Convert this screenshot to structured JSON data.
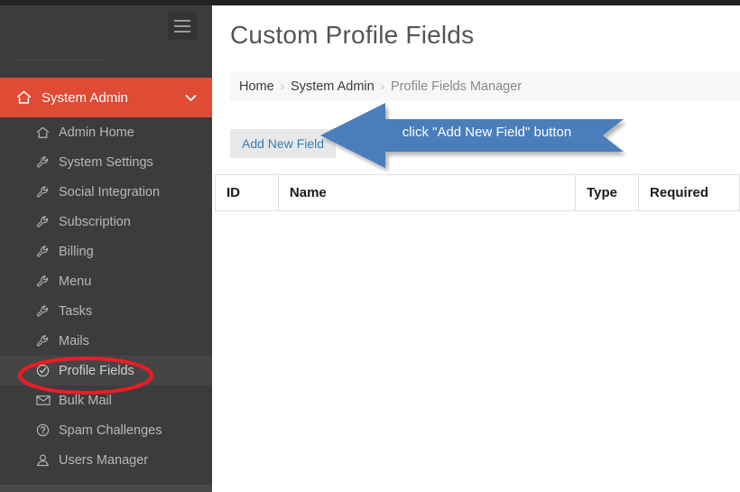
{
  "sidebar": {
    "hamburger_icon": "hamburger-menu-icon",
    "section": {
      "icon": "home-icon",
      "label": "System Admin",
      "chevron_icon": "chevron-down-icon"
    },
    "items": [
      {
        "label": "Admin Home",
        "icon": "home-icon",
        "active": false
      },
      {
        "label": "System Settings",
        "icon": "wrench-icon",
        "active": false
      },
      {
        "label": "Social Integration",
        "icon": "wrench-icon",
        "active": false
      },
      {
        "label": "Subscription",
        "icon": "wrench-icon",
        "active": false
      },
      {
        "label": "Billing",
        "icon": "wrench-icon",
        "active": false
      },
      {
        "label": "Menu",
        "icon": "wrench-icon",
        "active": false
      },
      {
        "label": "Tasks",
        "icon": "wrench-icon",
        "active": false
      },
      {
        "label": "Mails",
        "icon": "wrench-icon",
        "active": false
      },
      {
        "label": "Profile Fields",
        "icon": "check-circle-icon",
        "active": true
      },
      {
        "label": "Bulk Mail",
        "icon": "envelope-icon",
        "active": false
      },
      {
        "label": "Spam Challenges",
        "icon": "question-circle-icon",
        "active": false
      },
      {
        "label": "Users Manager",
        "icon": "user-icon",
        "active": false
      }
    ]
  },
  "main": {
    "title": "Custom Profile Fields",
    "breadcrumb": [
      {
        "label": "Home",
        "last": false
      },
      {
        "label": "System Admin",
        "last": false
      },
      {
        "label": "Profile Fields Manager",
        "last": true
      }
    ],
    "breadcrumb_separator": "›",
    "add_button_label": "Add New Field",
    "table": {
      "columns": [
        "ID",
        "Name",
        "Type",
        "Required"
      ],
      "rows": []
    }
  },
  "annotations": {
    "arrow_text": "click \"Add New Field\" button",
    "arrow_color": "#4a7ebb",
    "ellipse_color": "#ee1c25",
    "ellipse_target": "Profile Fields"
  },
  "colors": {
    "sidebar_bg": "#3c3c3c",
    "accent_red": "#e04b36",
    "link_blue": "#2f7fb5",
    "top_strip": "#222222"
  }
}
